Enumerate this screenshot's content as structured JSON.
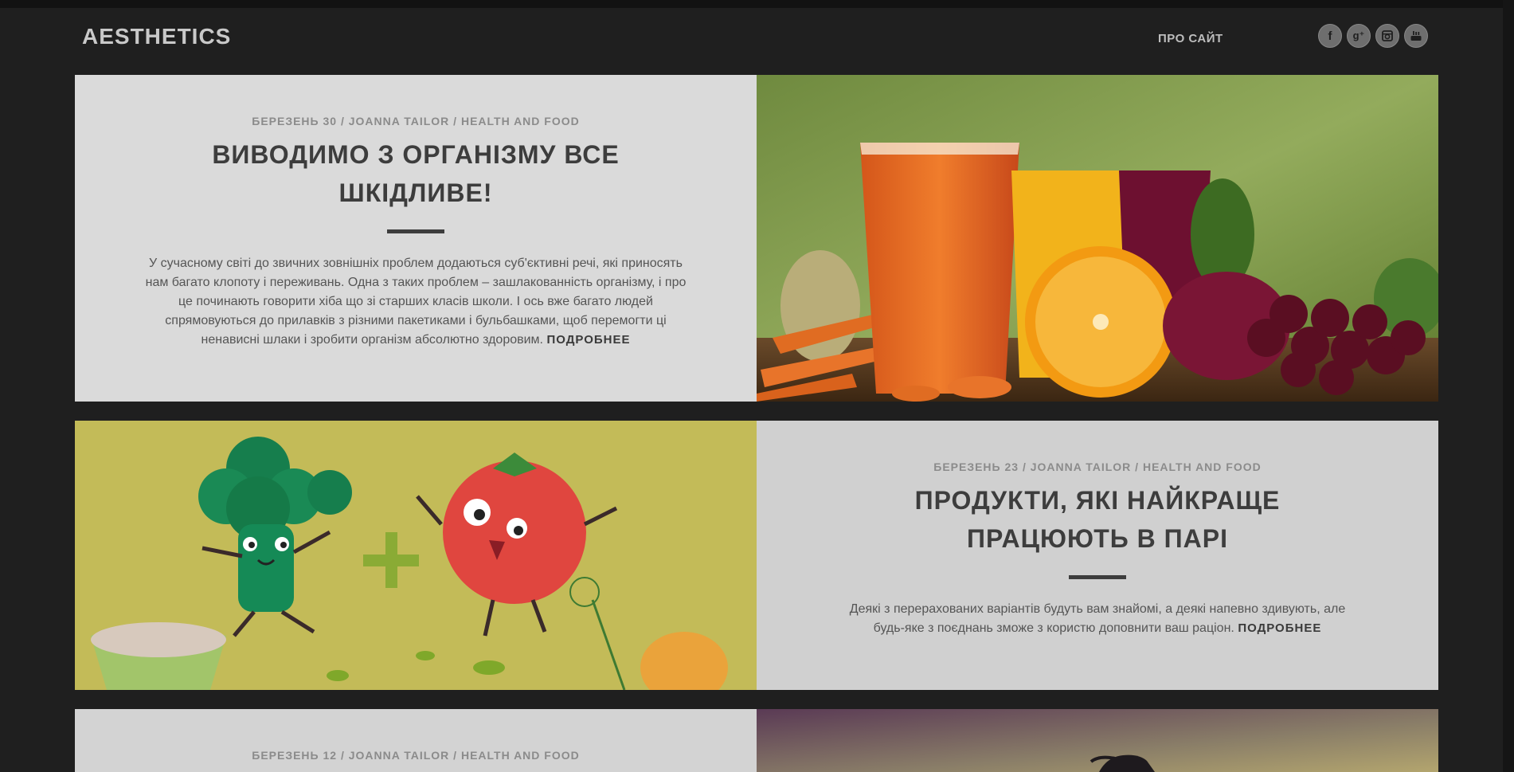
{
  "site": {
    "logo": "AESTHETICS"
  },
  "nav": {
    "about": "ПРО САЙТ"
  },
  "social": [
    {
      "icon": "facebook-icon",
      "glyph": "f"
    },
    {
      "icon": "google-plus-icon",
      "glyph": "g⁺"
    },
    {
      "icon": "instagram-icon",
      "glyph": ""
    },
    {
      "icon": "youtube-icon",
      "glyph": ""
    }
  ],
  "posts": [
    {
      "meta": "БЕРЕЗЕНЬ 30 / JOANNA TAILOR / HEALTH AND FOOD",
      "title": "ВИВОДИМО З ОРГАНІЗМУ ВСЕ ШКІДЛИВЕ!",
      "excerpt": "У сучасному світі до звичних зовнішніх проблем додаються суб'єктивні речі, які приносять нам багато клопоту і переживань. Одна з таких проблем – зашлакованність організму, і про це починають говорити хіба що зі старших класів школи. І ось вже багато людей спрямовуються до прилавків з різними пакетиками і бульбашками, щоб перемогти ці ненависні шлаки і зробити організм абсолютно здоровим.",
      "more": "ПОДРОБНЕЕ"
    },
    {
      "meta": "БЕРЕЗЕНЬ 23 / JOANNA TAILOR / HEALTH AND FOOD",
      "title": "ПРОДУКТИ, ЯКІ НАЙКРАЩЕ ПРАЦЮЮТЬ В ПАРІ",
      "excerpt": "Деякі з перерахованих варіантів будуть вам знайомі, а деякі напевно здивують, але будь-яке з поєднань зможе з користю доповнити ваш раціон.",
      "more": "ПОДРОБНЕЕ"
    },
    {
      "meta": "БЕРЕЗЕНЬ 12 / JOANNA TAILOR / HEALTH AND FOOD"
    }
  ]
}
